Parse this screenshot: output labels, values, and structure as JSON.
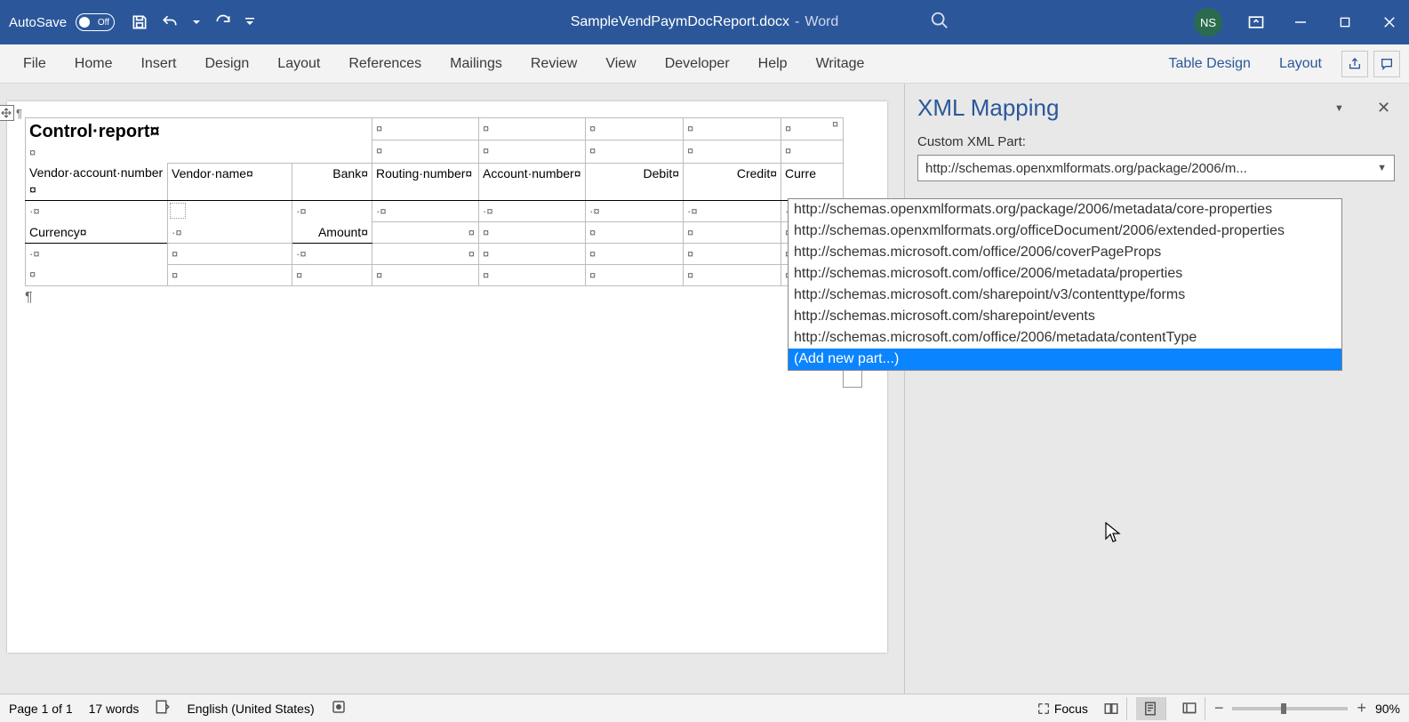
{
  "titlebar": {
    "autosave_label": "AutoSave",
    "autosave_state": "Off",
    "doc_name": "SampleVendPaymDocReport.docx",
    "app_name": "Word",
    "user_initials": "NS"
  },
  "ribbon": {
    "tabs": [
      "File",
      "Home",
      "Insert",
      "Design",
      "Layout",
      "References",
      "Mailings",
      "Review",
      "View",
      "Developer",
      "Help",
      "Writage"
    ],
    "context_tabs": [
      "Table Design",
      "Layout"
    ]
  },
  "doc": {
    "title": "Control·report¤",
    "headers": {
      "vendor_account": "Vendor·account·number¤",
      "vendor_name": "Vendor·name¤",
      "bank": "Bank¤",
      "routing": "Routing·number¤",
      "account": "Account·number¤",
      "debit": "Debit¤",
      "credit": "Credit¤",
      "currency_col": "Curre",
      "currency": "Currency¤",
      "amount": "Amount¤"
    }
  },
  "pane": {
    "title": "XML Mapping",
    "label": "Custom XML Part:",
    "selected": "http://schemas.openxmlformats.org/package/2006/m...",
    "options": [
      "http://schemas.openxmlformats.org/package/2006/metadata/core-properties",
      "http://schemas.openxmlformats.org/officeDocument/2006/extended-properties",
      "http://schemas.microsoft.com/office/2006/coverPageProps",
      "http://schemas.microsoft.com/office/2006/metadata/properties",
      "http://schemas.microsoft.com/sharepoint/v3/contenttype/forms",
      "http://schemas.microsoft.com/sharepoint/events",
      "http://schemas.microsoft.com/office/2006/metadata/contentType",
      "(Add new part...)"
    ],
    "highlighted_index": 7
  },
  "statusbar": {
    "page": "Page 1 of 1",
    "words": "17 words",
    "language": "English (United States)",
    "focus": "Focus",
    "zoom": "90%"
  }
}
